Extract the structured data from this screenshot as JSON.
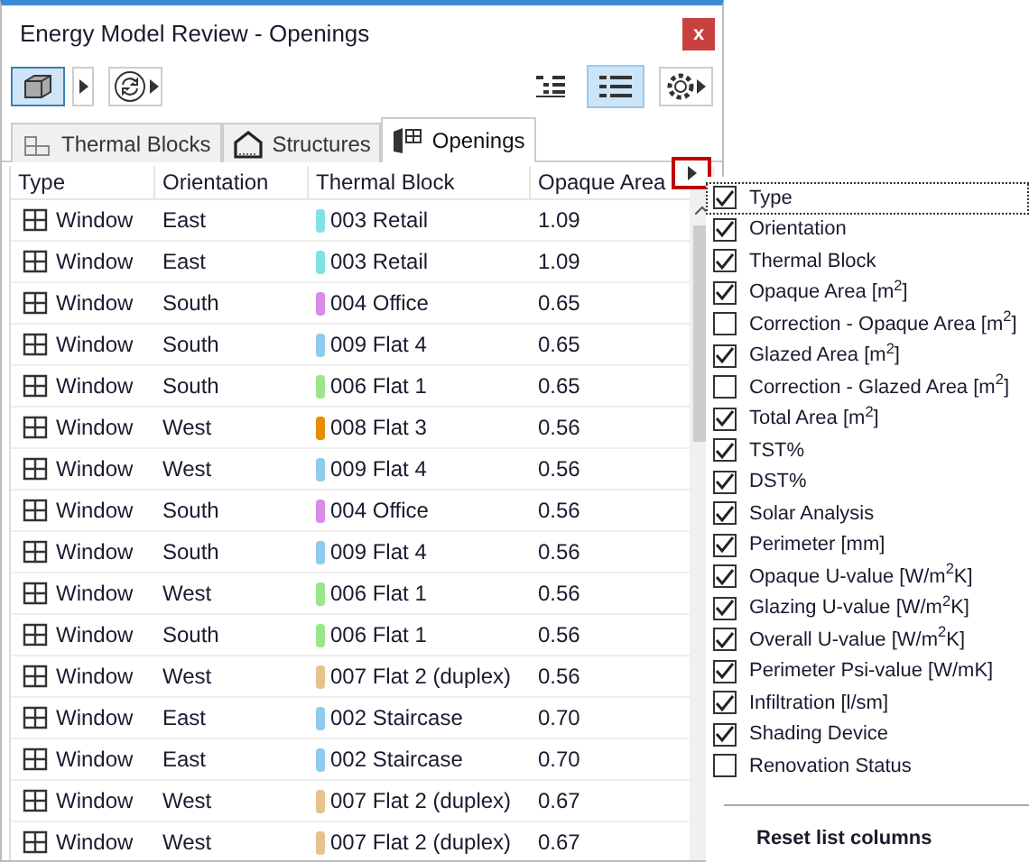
{
  "window": {
    "title": "Energy Model Review - Openings",
    "close": "x"
  },
  "view_toggles": [
    {
      "kind": "tree",
      "selected": false
    },
    {
      "kind": "list",
      "selected": true
    }
  ],
  "tabs": [
    {
      "label": "Thermal Blocks",
      "kind": "blocks",
      "selected": false
    },
    {
      "label": "Structures",
      "kind": "structures",
      "selected": false
    },
    {
      "label": "Openings",
      "kind": "openings",
      "selected": true
    }
  ],
  "table": {
    "columns": [
      "Type",
      "Orientation",
      "Thermal Block",
      "Opaque Area"
    ],
    "rows": [
      {
        "type": "Window",
        "orientation": "East",
        "block": "003 Retail",
        "color": "#7fe3e6",
        "opaque_area": "1.09"
      },
      {
        "type": "Window",
        "orientation": "East",
        "block": "003 Retail",
        "color": "#7fe3e6",
        "opaque_area": "1.09"
      },
      {
        "type": "Window",
        "orientation": "South",
        "block": "004 Office",
        "color": "#d98be8",
        "opaque_area": "0.65"
      },
      {
        "type": "Window",
        "orientation": "South",
        "block": "009 Flat 4",
        "color": "#8ecbec",
        "opaque_area": "0.65"
      },
      {
        "type": "Window",
        "orientation": "South",
        "block": "006 Flat 1",
        "color": "#9be68a",
        "opaque_area": "0.65"
      },
      {
        "type": "Window",
        "orientation": "West",
        "block": "008 Flat 3",
        "color": "#e88c00",
        "opaque_area": "0.56"
      },
      {
        "type": "Window",
        "orientation": "West",
        "block": "009 Flat 4",
        "color": "#8ecbec",
        "opaque_area": "0.56"
      },
      {
        "type": "Window",
        "orientation": "South",
        "block": "004 Office",
        "color": "#d98be8",
        "opaque_area": "0.56"
      },
      {
        "type": "Window",
        "orientation": "South",
        "block": "009 Flat 4",
        "color": "#8ecbec",
        "opaque_area": "0.56"
      },
      {
        "type": "Window",
        "orientation": "West",
        "block": "006 Flat 1",
        "color": "#9be68a",
        "opaque_area": "0.56"
      },
      {
        "type": "Window",
        "orientation": "South",
        "block": "006 Flat 1",
        "color": "#9be68a",
        "opaque_area": "0.56"
      },
      {
        "type": "Window",
        "orientation": "West",
        "block": "007 Flat 2 (duplex)",
        "color": "#e6c28c",
        "opaque_area": "0.56"
      },
      {
        "type": "Window",
        "orientation": "East",
        "block": "002 Staircase",
        "color": "#8ecbec",
        "opaque_area": "0.70"
      },
      {
        "type": "Window",
        "orientation": "East",
        "block": "002 Staircase",
        "color": "#8ecbec",
        "opaque_area": "0.70"
      },
      {
        "type": "Window",
        "orientation": "West",
        "block": "007 Flat 2 (duplex)",
        "color": "#e6c28c",
        "opaque_area": "0.67"
      },
      {
        "type": "Window",
        "orientation": "West",
        "block": "007 Flat 2 (duplex)",
        "color": "#e6c28c",
        "opaque_area": "0.67"
      }
    ]
  },
  "column_menu": {
    "items": [
      {
        "label": "Type",
        "checked": true,
        "selected": true
      },
      {
        "label": "Orientation",
        "checked": true,
        "selected": false
      },
      {
        "label": "Thermal Block",
        "checked": true,
        "selected": false
      },
      {
        "label": "Opaque Area [m$^{2}$]",
        "checked": true,
        "selected": false
      },
      {
        "label": "Correction - Opaque Area [m$^{2}$]",
        "checked": false,
        "selected": false
      },
      {
        "label": "Glazed Area [m$^{2}$]",
        "checked": true,
        "selected": false
      },
      {
        "label": "Correction - Glazed Area [m$^{2}$]",
        "checked": false,
        "selected": false
      },
      {
        "label": "Total Area [m$^{2}$]",
        "checked": true,
        "selected": false
      },
      {
        "label": "TST%",
        "checked": true,
        "selected": false
      },
      {
        "label": "DST%",
        "checked": true,
        "selected": false
      },
      {
        "label": "Solar Analysis",
        "checked": true,
        "selected": false
      },
      {
        "label": "Perimeter [mm]",
        "checked": true,
        "selected": false
      },
      {
        "label": "Opaque U-value [W/m$^{2}$K]",
        "checked": true,
        "selected": false
      },
      {
        "label": "Glazing U-value [W/m$^{2}$K]",
        "checked": true,
        "selected": false
      },
      {
        "label": "Overall U-value [W/m$^{2}$K]",
        "checked": true,
        "selected": false
      },
      {
        "label": "Perimeter Psi-value [W/mK]",
        "checked": true,
        "selected": false
      },
      {
        "label": "Infiltration [l/sm]",
        "checked": true,
        "selected": false
      },
      {
        "label": "Shading Device",
        "checked": true,
        "selected": false
      },
      {
        "label": "Renovation Status",
        "checked": false,
        "selected": false
      }
    ],
    "reset": "Reset list columns"
  }
}
